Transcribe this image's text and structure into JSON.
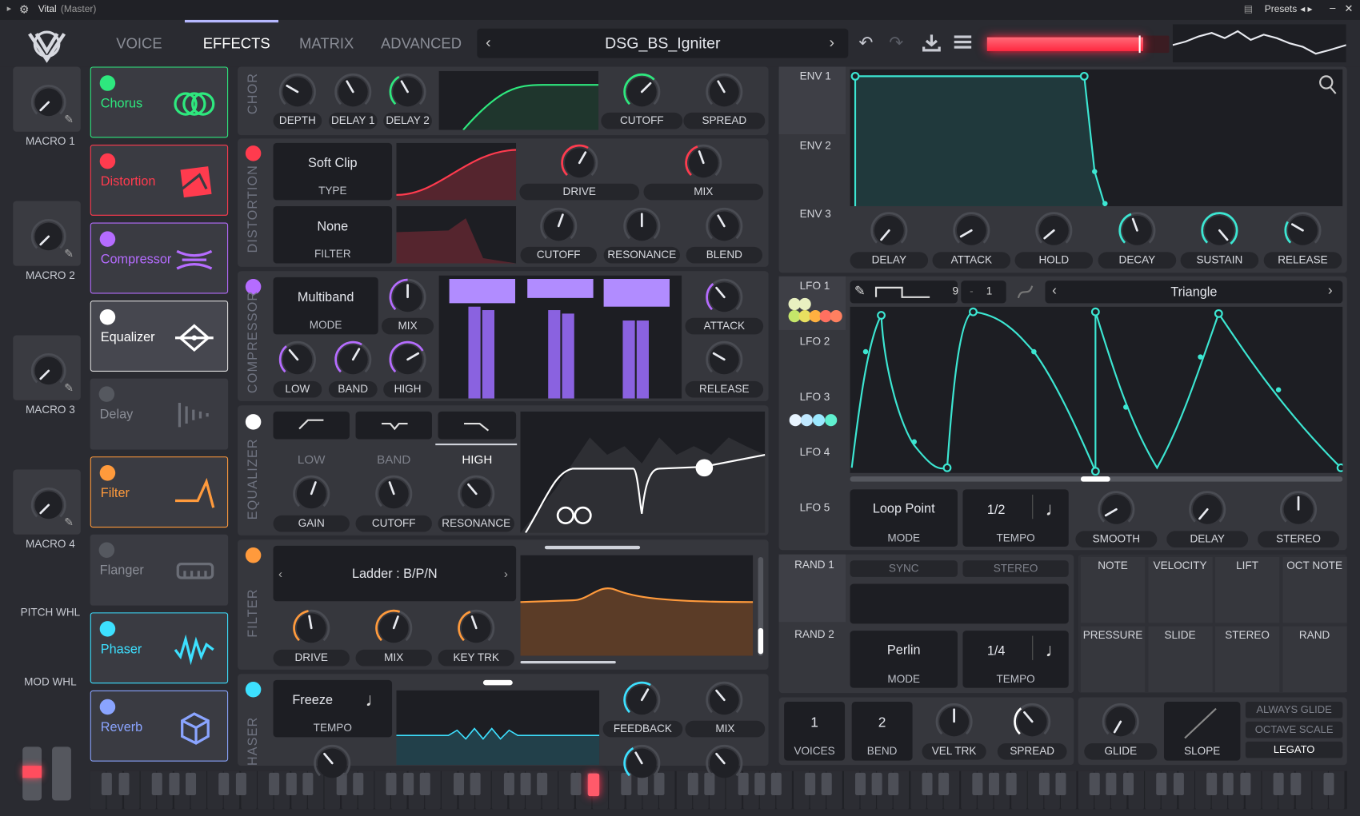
{
  "window": {
    "title": "Vital",
    "subtitle": "(Master)",
    "presets_label": "Presets"
  },
  "tabs": [
    {
      "label": "VOICE"
    },
    {
      "label": "EFFECTS"
    },
    {
      "label": "MATRIX"
    },
    {
      "label": "ADVANCED"
    }
  ],
  "preset_name": "DSG_BS_Igniter",
  "macros": [
    {
      "label": "MACRO 1"
    },
    {
      "label": "MACRO 2"
    },
    {
      "label": "MACRO 3"
    },
    {
      "label": "MACRO 4"
    }
  ],
  "pitch_wheel_label": "PITCH WHL",
  "mod_wheel_label": "MOD WHL",
  "fx_list": [
    {
      "name": "Chorus",
      "color": "#2ee87e",
      "icon": "chorus-icon",
      "active": true
    },
    {
      "name": "Distortion",
      "color": "#ff3b4e",
      "icon": "distortion-icon",
      "active": true
    },
    {
      "name": "Compressor",
      "color": "#b56cff",
      "icon": "compressor-icon",
      "active": true
    },
    {
      "name": "Equalizer",
      "color": "#ffffff",
      "icon": "equalizer-icon",
      "active": true
    },
    {
      "name": "Delay",
      "color": "#55585f",
      "icon": "delay-icon",
      "active": false
    },
    {
      "name": "Filter",
      "color": "#ff9a3c",
      "icon": "filter-icon",
      "active": true
    },
    {
      "name": "Flanger",
      "color": "#55585f",
      "icon": "flanger-icon",
      "active": false
    },
    {
      "name": "Phaser",
      "color": "#3de0ff",
      "icon": "phaser-icon",
      "active": true
    },
    {
      "name": "Reverb",
      "color": "#8aa4ff",
      "icon": "reverb-icon",
      "active": true
    }
  ],
  "chorus": {
    "title": "CHOR",
    "knobs": [
      "DEPTH",
      "DELAY 1",
      "DELAY 2"
    ],
    "knobs2": [
      "CUTOFF",
      "SPREAD"
    ]
  },
  "distortion": {
    "title": "DISTORTION",
    "type": "Soft Clip",
    "type_label": "TYPE",
    "filter": "None",
    "filter_label": "FILTER",
    "knobs": [
      "DRIVE",
      "MIX"
    ],
    "knobs2": [
      "CUTOFF",
      "RESONANCE",
      "BLEND"
    ]
  },
  "compressor": {
    "title": "COMPRESSOR",
    "mode": "Multiband",
    "mode_label": "MODE",
    "knobs": [
      "MIX",
      "LOW",
      "BAND",
      "HIGH"
    ],
    "knobs2": [
      "ATTACK",
      "RELEASE"
    ]
  },
  "equalizer": {
    "title": "EQUALIZER",
    "bands": [
      "LOW",
      "BAND",
      "HIGH"
    ],
    "knobs": [
      "GAIN",
      "CUTOFF",
      "RESONANCE"
    ]
  },
  "filter": {
    "title": "FILTER",
    "model": "Ladder  :  B/P/N",
    "knobs": [
      "DRIVE",
      "MIX",
      "KEY TRK"
    ]
  },
  "phaser": {
    "title": "HASER",
    "tempo_val": "Freeze",
    "tempo_label": "TEMPO",
    "knobs": [
      "FEEDBACK",
      "MIX"
    ]
  },
  "env": {
    "labels": [
      "ENV 1",
      "ENV 2",
      "ENV 3"
    ],
    "knobs": [
      "DELAY",
      "ATTACK",
      "HOLD",
      "DECAY",
      "SUSTAIN",
      "RELEASE"
    ]
  },
  "lfo": {
    "labels": [
      "LFO 1",
      "LFO 2",
      "LFO 3",
      "LFO 4",
      "LFO 5"
    ],
    "grid_a": "9",
    "grid_sep": "-",
    "grid_b": "1",
    "shape": "Triangle",
    "mode": "Loop Point",
    "mode_label": "MODE",
    "tempo": "1/2",
    "tempo_label": "TEMPO",
    "knobs": [
      "SMOOTH",
      "DELAY",
      "STEREO"
    ]
  },
  "rand": {
    "labels": [
      "RAND 1",
      "RAND 2"
    ],
    "sync": "SYNC",
    "stereo": "STEREO",
    "mode": "Perlin",
    "mode_label": "MODE",
    "tempo": "1/4",
    "tempo_label": "TEMPO"
  },
  "mod_sources": [
    "NOTE",
    "VELOCITY",
    "LIFT",
    "OCT NOTE",
    "PRESSURE",
    "SLIDE",
    "STEREO",
    "RAND"
  ],
  "voice": {
    "voices": "1",
    "voices_label": "VOICES",
    "bend": "2",
    "bend_label": "BEND",
    "knobs": [
      "VEL TRK",
      "SPREAD"
    ],
    "glide": "GLIDE",
    "slope": "SLOPE",
    "opts": [
      "ALWAYS GLIDE",
      "OCTAVE SCALE",
      "LEGATO"
    ]
  }
}
